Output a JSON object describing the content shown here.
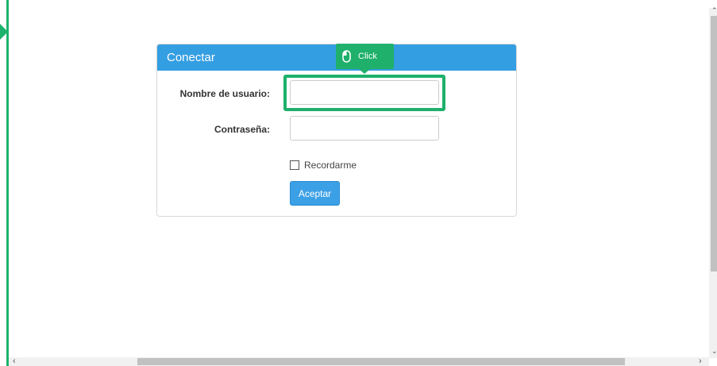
{
  "panel": {
    "title": "Conectar"
  },
  "form": {
    "username_label": "Nombre de usuario:",
    "username_value": "",
    "password_label": "Contraseña:",
    "password_value": "",
    "remember_label": "Recordarme",
    "remember_checked": false,
    "submit_label": "Aceptar"
  },
  "tooltip": {
    "label": "Click",
    "icon": "mouse-icon"
  },
  "colors": {
    "accent": "#349ee2",
    "highlight": "#1fb06b",
    "button": "#3ca0e6"
  }
}
